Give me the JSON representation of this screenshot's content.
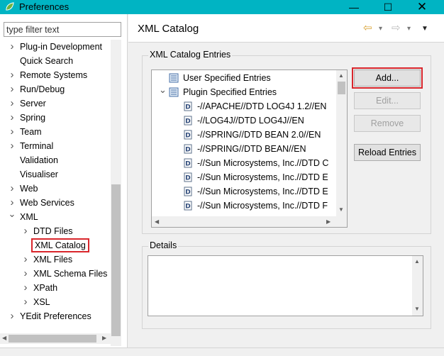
{
  "window": {
    "title": "Preferences",
    "minimize": "—",
    "maximize": "☐",
    "close": "✕"
  },
  "filter": {
    "placeholder": "type filter text"
  },
  "tree": [
    {
      "label": "Plug-in Development",
      "expandable": true
    },
    {
      "label": "Quick Search",
      "expandable": false
    },
    {
      "label": "Remote Systems",
      "expandable": true
    },
    {
      "label": "Run/Debug",
      "expandable": true
    },
    {
      "label": "Server",
      "expandable": true
    },
    {
      "label": "Spring",
      "expandable": true
    },
    {
      "label": "Team",
      "expandable": true
    },
    {
      "label": "Terminal",
      "expandable": true
    },
    {
      "label": "Validation",
      "expandable": false
    },
    {
      "label": "Visualiser",
      "expandable": false
    },
    {
      "label": "Web",
      "expandable": true
    },
    {
      "label": "Web Services",
      "expandable": true
    },
    {
      "label": "XML",
      "expandable": true,
      "expanded": true
    },
    {
      "label": "DTD Files",
      "expandable": true,
      "child": true
    },
    {
      "label": "XML Catalog",
      "expandable": false,
      "child": true,
      "selected": true
    },
    {
      "label": "XML Files",
      "expandable": true,
      "child": true
    },
    {
      "label": "XML Schema Files",
      "expandable": true,
      "child": true
    },
    {
      "label": "XPath",
      "expandable": true,
      "child": true
    },
    {
      "label": "XSL",
      "expandable": true,
      "child": true
    },
    {
      "label": "YEdit Preferences",
      "expandable": true
    }
  ],
  "page": {
    "title": "XML Catalog",
    "back": "⇦",
    "forward": "⇨",
    "dropdown": "▾",
    "menu": "▼"
  },
  "entries_group": {
    "label": "XML Catalog Entries"
  },
  "entries": [
    {
      "label": "User Specified Entries",
      "type": "catalog",
      "level": 0
    },
    {
      "label": "Plugin Specified Entries",
      "type": "catalog",
      "level": 0,
      "expanded": true
    },
    {
      "label": "-//APACHE//DTD LOG4J 1.2//EN",
      "type": "dtd",
      "level": 1
    },
    {
      "label": "-//LOG4J//DTD LOG4J//EN",
      "type": "dtd",
      "level": 1
    },
    {
      "label": "-//SPRING//DTD BEAN 2.0//EN",
      "type": "dtd",
      "level": 1
    },
    {
      "label": "-//SPRING//DTD BEAN//EN",
      "type": "dtd",
      "level": 1
    },
    {
      "label": "-//Sun Microsystems, Inc.//DTD C",
      "type": "dtd",
      "level": 1
    },
    {
      "label": "-//Sun Microsystems, Inc.//DTD E",
      "type": "dtd",
      "level": 1
    },
    {
      "label": "-//Sun Microsystems, Inc.//DTD E",
      "type": "dtd",
      "level": 1
    },
    {
      "label": "-//Sun Microsystems, Inc.//DTD F",
      "type": "dtd",
      "level": 1
    }
  ],
  "buttons": {
    "add": "Add...",
    "edit": "Edit...",
    "remove": "Remove",
    "reload": "Reload Entries"
  },
  "details_group": {
    "label": "Details"
  },
  "colors": {
    "titlebar": "#00b4c3",
    "highlight": "#d9262c"
  }
}
